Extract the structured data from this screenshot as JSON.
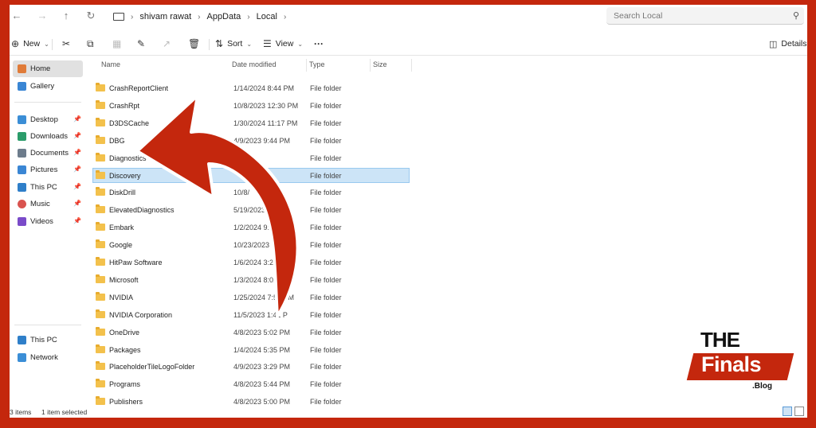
{
  "address": {
    "breadcrumbs": [
      "shivam rawat",
      "AppData",
      "Local"
    ],
    "search_placeholder": "Search Local"
  },
  "toolbar": {
    "new_label": "New",
    "sort_label": "Sort",
    "view_label": "View",
    "more_label": "···",
    "details_label": "Details"
  },
  "sidebar": {
    "top": [
      {
        "label": "Home",
        "icon": "home-icon"
      },
      {
        "label": "Gallery",
        "icon": "gallery-icon"
      }
    ],
    "pinned": [
      {
        "label": "Desktop",
        "icon": "desktop-icon"
      },
      {
        "label": "Downloads",
        "icon": "downloads-icon"
      },
      {
        "label": "Documents",
        "icon": "documents-icon"
      },
      {
        "label": "Pictures",
        "icon": "pictures-icon"
      },
      {
        "label": "This PC",
        "icon": "pc-icon"
      },
      {
        "label": "Music",
        "icon": "music-icon"
      },
      {
        "label": "Videos",
        "icon": "videos-icon"
      }
    ],
    "bottom": [
      {
        "label": "This PC",
        "icon": "pc-icon"
      },
      {
        "label": "Network",
        "icon": "network-icon"
      }
    ]
  },
  "columns": {
    "name": "Name",
    "date": "Date modified",
    "type": "Type",
    "size": "Size"
  },
  "files": [
    {
      "name": "CrashReportClient",
      "date": "1/14/2024 8:44 PM",
      "type": "File folder"
    },
    {
      "name": "CrashRpt",
      "date": "10/8/2023 12:30 PM",
      "type": "File folder"
    },
    {
      "name": "D3DSCache",
      "date": "1/30/2024 11:17 PM",
      "type": "File folder"
    },
    {
      "name": "DBG",
      "date": "4/9/2023 9:44 PM",
      "type": "File folder"
    },
    {
      "name": "Diagnostics",
      "date": "",
      "type": "File folder"
    },
    {
      "name": "Discovery",
      "date": "",
      "type": "File folder",
      "selected": true
    },
    {
      "name": "DiskDrill",
      "date": "10/8/",
      "type": "File folder"
    },
    {
      "name": "ElevatedDiagnostics",
      "date": "5/19/2023 6:55",
      "type": "File folder"
    },
    {
      "name": "Embark",
      "date": "1/2/2024 9:59 PM",
      "type": "File folder"
    },
    {
      "name": "Google",
      "date": "10/23/2023 4:46 PM",
      "type": "File folder"
    },
    {
      "name": "HitPaw Software",
      "date": "1/6/2024 3:28 PM",
      "type": "File folder"
    },
    {
      "name": "Microsoft",
      "date": "1/3/2024 8:01 PM",
      "type": "File folder"
    },
    {
      "name": "NVIDIA",
      "date": "1/25/2024 7:54 PM",
      "type": "File folder"
    },
    {
      "name": "NVIDIA Corporation",
      "date": "11/5/2023 1:41 P",
      "type": "File folder"
    },
    {
      "name": "OneDrive",
      "date": "4/8/2023 5:02 PM",
      "type": "File folder"
    },
    {
      "name": "Packages",
      "date": "1/4/2024 5:35 PM",
      "type": "File folder"
    },
    {
      "name": "PlaceholderTileLogoFolder",
      "date": "4/9/2023 3:29 PM",
      "type": "File folder"
    },
    {
      "name": "Programs",
      "date": "4/8/2023 5:44 PM",
      "type": "File folder"
    },
    {
      "name": "Publishers",
      "date": "4/8/2023 5:00 PM",
      "type": "File folder"
    }
  ],
  "status": {
    "items": "3 items",
    "selected": "1 item selected"
  },
  "logo": {
    "the": "THE",
    "finals": "Finals",
    "blog": ".Blog"
  },
  "colors": {
    "border_red": "#c4270d",
    "selection": "#cce4f7",
    "folder": "#f3c14c"
  }
}
